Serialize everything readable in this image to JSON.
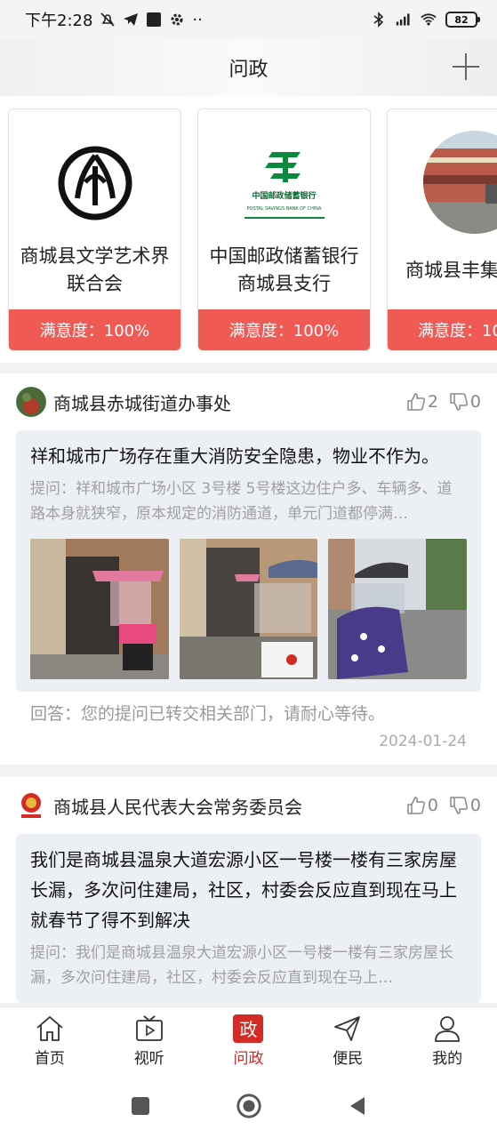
{
  "status_bar": {
    "time": "下午2:28",
    "battery": "82",
    "more": "··",
    "icons": [
      "mute-icon",
      "telegram-icon",
      "square-icon",
      "gear-icon",
      "bluetooth-icon",
      "signal-icon",
      "wifi-icon",
      "battery-icon"
    ]
  },
  "header": {
    "title": "问政",
    "add_icon": "plus-icon"
  },
  "organizations": [
    {
      "name": "商城县文学艺术界联合会",
      "satisfaction": "满意度：100%"
    },
    {
      "name": "中国邮政储蓄银行商城县支行",
      "satisfaction": "满意度：100%",
      "logo_text": "中国邮政储蓄银行",
      "logo_subtext": "POSTAL SAVINGS BANK OF CHINA"
    },
    {
      "name": "商城县丰集",
      "satisfaction": "满意度：10"
    }
  ],
  "posts": [
    {
      "department": "商城县赤城街道办事处",
      "likes": "2",
      "dislikes": "0",
      "title": "祥和城市广场存在重大消防安全隐患，物业不作为。",
      "question": "提问：祥和城市广场小区 3号楼 5号楼这边住户多、车辆多、道路本身就狭窄，原本规定的消防通道，单元门道都停满…",
      "photo_count": 3,
      "answer": "回答：您的提问已转交相关部门，请耐心等待。",
      "date": "2024-01-24"
    },
    {
      "department": "商城县人民代表大会常务委员会",
      "likes": "0",
      "dislikes": "0",
      "title": "我们是商城县温泉大道宏源小区一号楼一楼有三家房屋长漏，多次问住建局，社区，村委会反应直到现在马上就春节了得不到解决",
      "question": "提问：我们是商城县温泉大道宏源小区一号楼一楼有三家房屋长漏，多次问住建局，社区，村委会反应直到现在马上…"
    }
  ],
  "tabs": [
    {
      "label": "首页",
      "icon": "home-icon",
      "active": false
    },
    {
      "label": "视听",
      "icon": "tv-icon",
      "active": false
    },
    {
      "label": "问政",
      "icon": "zheng-icon",
      "glyph": "政",
      "active": true
    },
    {
      "label": "便民",
      "icon": "send-icon",
      "active": false
    },
    {
      "label": "我的",
      "icon": "user-icon",
      "active": false
    }
  ],
  "colors": {
    "accent": "#d42b26",
    "satisfaction_bar": "#f05a55",
    "question_bg": "#ecf0f5"
  }
}
